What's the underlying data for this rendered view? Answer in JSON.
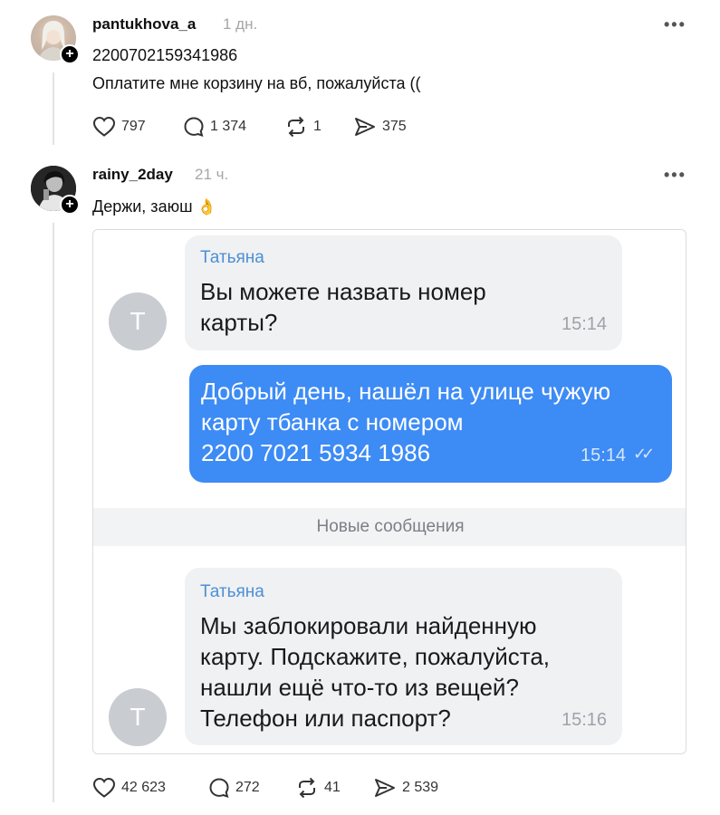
{
  "post1": {
    "username": "pantukhova_a",
    "time": "1 дн.",
    "more_label": "•••",
    "line1": "2200702159341986",
    "line2": "Оплатите мне корзину на вб, пожалуйста ((",
    "likes": "797",
    "comments": "1 374",
    "reposts": "1",
    "shares": "375"
  },
  "post2": {
    "username": "rainy_2day",
    "time": "21 ч.",
    "more_label": "•••",
    "text": "Держи, заюш",
    "emoji": "👌",
    "likes": "42 623",
    "comments": "272",
    "reposts": "41",
    "shares": "2 539"
  },
  "badge_plus": "+",
  "chat": {
    "avatar_letter": "Т",
    "messages": [
      {
        "sender": "Татьяна",
        "line1": "Вы можете назвать номер",
        "line2": "карты?",
        "time": "15:14"
      },
      {
        "line1": "Добрый день, нашёл на улице чужую",
        "line2": "карту тбанка с номером",
        "line3": "2200 7021 5934 1986",
        "time": "15:14",
        "read_mark": "✓✓"
      },
      {
        "sender": "Татьяна",
        "line1": "Мы заблокировали найденную",
        "line2": "карту. Подскажите, пожалуйста,",
        "line3": "нашли ещё что-то из вещей?",
        "line4": "Телефон или паспорт?",
        "time": "15:16"
      }
    ],
    "divider": "Новые сообщения"
  },
  "icons": {
    "like": "heart-icon",
    "comment": "comment-bubble-icon",
    "repost": "repost-icon",
    "share": "send-icon"
  }
}
